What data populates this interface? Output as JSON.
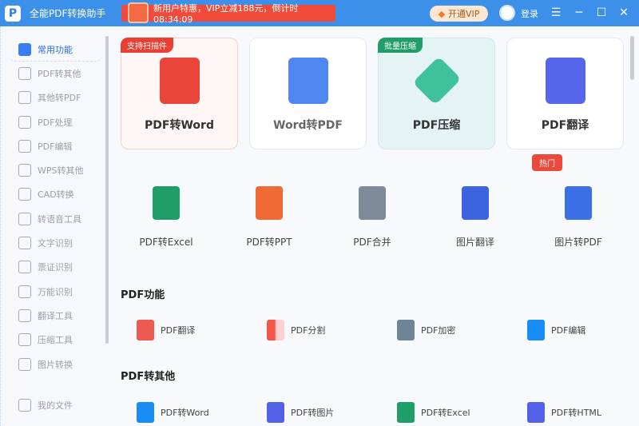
{
  "titlebar": {
    "app_name": "全能PDF转换助手",
    "promo": "新用户特惠，VIP立减188元，倒计时 08:34:09",
    "vip": "开通VIP",
    "login": "登录"
  },
  "sidebar": {
    "items": [
      "常用功能",
      "PDF转其他",
      "其他转PDF",
      "PDF处理",
      "PDF编辑",
      "WPS转其他",
      "CAD转换",
      "转语音工具",
      "文字识别",
      "票证识别",
      "万能识别",
      "翻译工具",
      "压缩工具",
      "图片转换"
    ],
    "my_files": "我的文件"
  },
  "cards": [
    {
      "label": "PDF转Word",
      "tag": "支持扫描件"
    },
    {
      "label": "Word转PDF"
    },
    {
      "label": "PDF压缩",
      "tag": "批量压缩"
    },
    {
      "label": "PDF翻译"
    }
  ],
  "tools": [
    "PDF转Excel",
    "PDF转PPT",
    "PDF合并",
    "图片翻译",
    "图片转PDF"
  ],
  "hot": "热门",
  "sections": [
    {
      "title": "PDF功能",
      "items": [
        "PDF翻译",
        "PDF分割",
        "PDF加密",
        "PDF编辑"
      ]
    },
    {
      "title": "PDF转其他",
      "items": [
        "PDF转Word",
        "PDF转图片",
        "PDF转Excel",
        "PDF转HTML"
      ]
    }
  ],
  "colors": {
    "accent": "#3d90ea",
    "red": "#ea4a3a",
    "green": "#1f9e6a"
  }
}
